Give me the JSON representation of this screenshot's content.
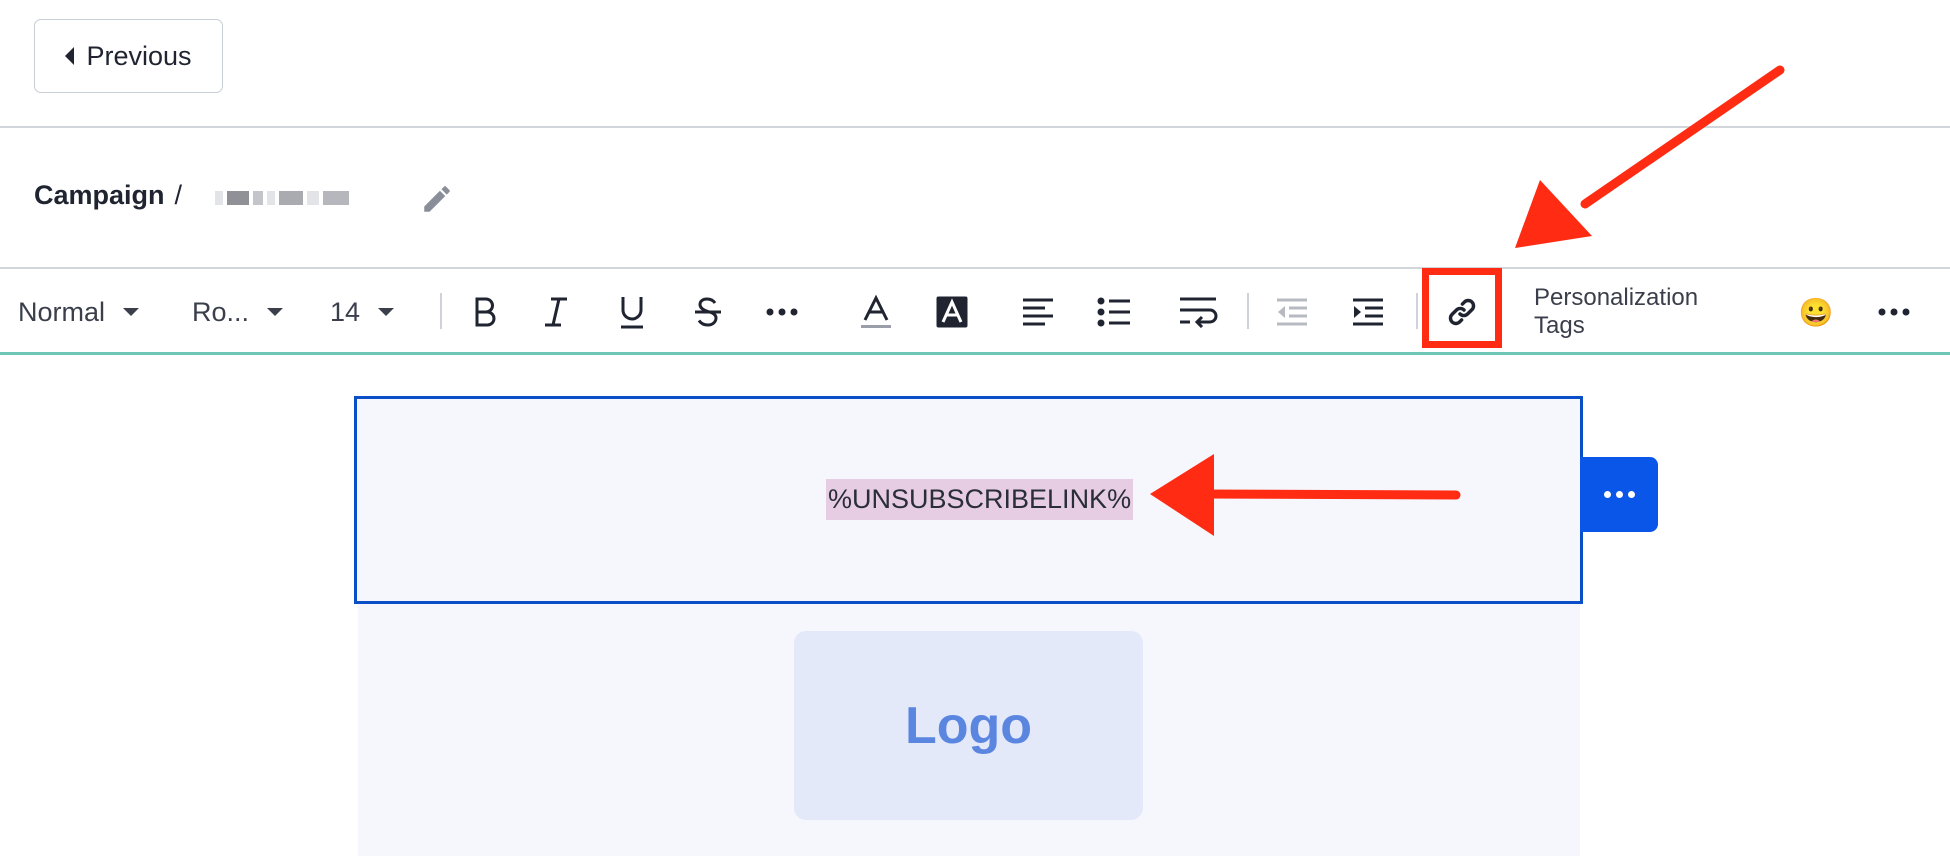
{
  "top_bar": {
    "previous_label": "Previous"
  },
  "campaign": {
    "label": "Campaign",
    "separator": "/"
  },
  "toolbar": {
    "paragraph_style": "Normal",
    "font_family": "Ro...",
    "font_size": "14",
    "personalization_tags_label": "Personalization Tags",
    "emoji": "😀"
  },
  "canvas": {
    "merge_tag": "%UNSUBSCRIBELINK%",
    "logo_placeholder": "Logo"
  },
  "colors": {
    "annotation_red": "#ff2b12",
    "selection_blue": "#0a4fc8",
    "action_blue": "#0a56e8",
    "toolbar_accent": "#6cc6b6",
    "merge_tag_highlight": "#e6cde4"
  }
}
